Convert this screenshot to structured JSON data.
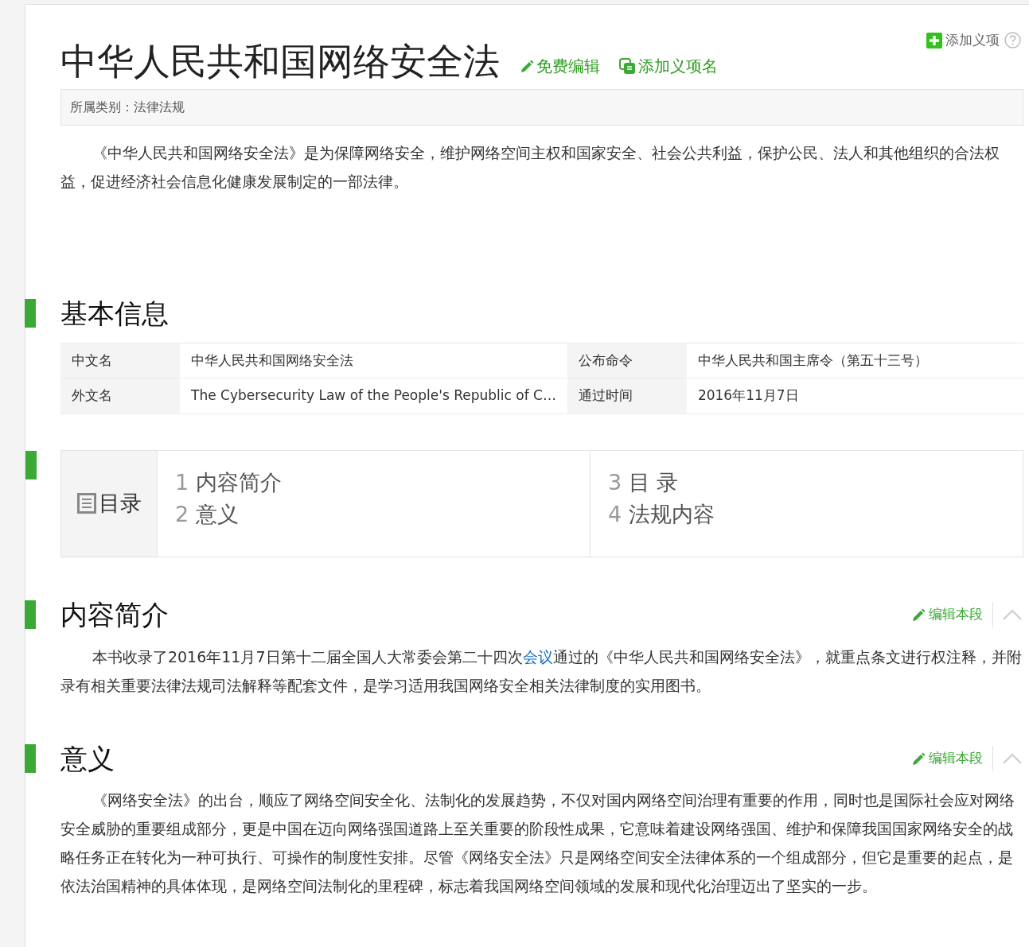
{
  "add_meaning": {
    "label": "添加义项"
  },
  "title": "中华人民共和国网络安全法",
  "title_actions": [
    {
      "kind": "edit",
      "label": "免费编辑"
    },
    {
      "kind": "add",
      "label": "添加义项名"
    }
  ],
  "category": "所属类别：法律法规",
  "summary": "《中华人民共和国网络安全法》是为保障网络安全，维护网络空间主权和国家安全、社会公共利益，保护公民、法人和其他组织的合法权益，促进经济社会信息化健康发展制定的一部法律。",
  "basic_info": {
    "heading": "基本信息",
    "rows": [
      [
        {
          "label": "中文名",
          "value": "中华人民共和国网络安全法"
        },
        {
          "label": "公布命令",
          "value": "中华人民共和国主席令（第五十三号）"
        }
      ],
      [
        {
          "label": "外文名",
          "value": "The Cybersecurity Law of the People's Republic of C…"
        },
        {
          "label": "通过时间",
          "value": "2016年11月7日"
        }
      ]
    ]
  },
  "toc": {
    "title": "目录",
    "columns": [
      [
        {
          "num": "1",
          "label": "内容简介"
        },
        {
          "num": "2",
          "label": "意义"
        }
      ],
      [
        {
          "num": "3",
          "label": "目 录"
        },
        {
          "num": "4",
          "label": "法规内容"
        }
      ]
    ]
  },
  "sections": [
    {
      "heading": "内容简介",
      "edit_label": "编辑本段",
      "paragraph": {
        "before": "本书收录了2016年11月7日第十二届全国人大常委会第二十四次",
        "link": "会议",
        "after": "通过的《中华人民共和国网络安全法》，就重点条文进行权注释，并附录有相关重要法律法规司法解释等配套文件，是学习适用我国网络安全相关法律制度的实用图书。"
      }
    },
    {
      "heading": "意义",
      "edit_label": "编辑本段",
      "paragraph": {
        "before": "《网络安全法》的出台，顺应了网络空间安全化、法制化的发展趋势，不仅对国内网络空间治理有重要的作用，同时也是国际社会应对网络安全威胁的重要组成部分，更是中国在迈向网络强国道路上至关重要的阶段性成果，它意味着建设网络强国、维护和保障我国国家网络安全的战略任务正在转化为一种可执行、可操作的制度性安排。尽管《网络安全法》只是网络空间安全法律体系的一个组成部分，但它是重要的起点，是依法治国精神的具体体现，是网络空间法制化的里程碑，标志着我国网络空间领域的发展和现代化治理迈出了坚实的一步。"
      }
    }
  ]
}
